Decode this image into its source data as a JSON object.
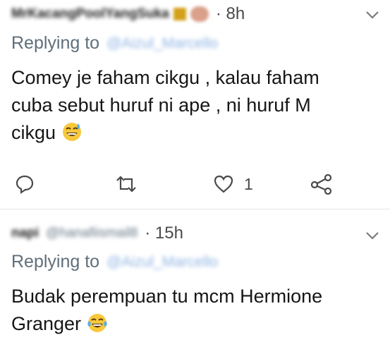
{
  "tweets": [
    {
      "user_name": "MrKacangPoolYangSuka",
      "handle": "",
      "time": "· 8h",
      "replying_label": "Replying to",
      "reply_to": "@Aizul_Marcello",
      "text_lines": [
        "Comey je faham cikgu , kalau faham",
        "cuba sebut huruf ni ape , ni huruf M",
        "cikgu"
      ],
      "emoji": "grinning-sweat",
      "actions": {
        "reply": "reply-icon",
        "retweet": "retweet-icon",
        "like": "heart-icon",
        "like_count": "1",
        "share": "share-icon"
      }
    },
    {
      "user_name": "napi",
      "handle": "@hanafiismail8",
      "time": "· 15h",
      "replying_label": "Replying to",
      "reply_to": "@Aizul_Marcello",
      "text_lines": [
        "Budak perempuan tu mcm Hermione",
        "Granger"
      ],
      "emoji": "tears-of-joy"
    }
  ],
  "colors": {
    "link_blurred": "#8fb4e3",
    "muted": "#657786",
    "divider": "#e1e8ed",
    "icon": "#4a4a4a"
  }
}
